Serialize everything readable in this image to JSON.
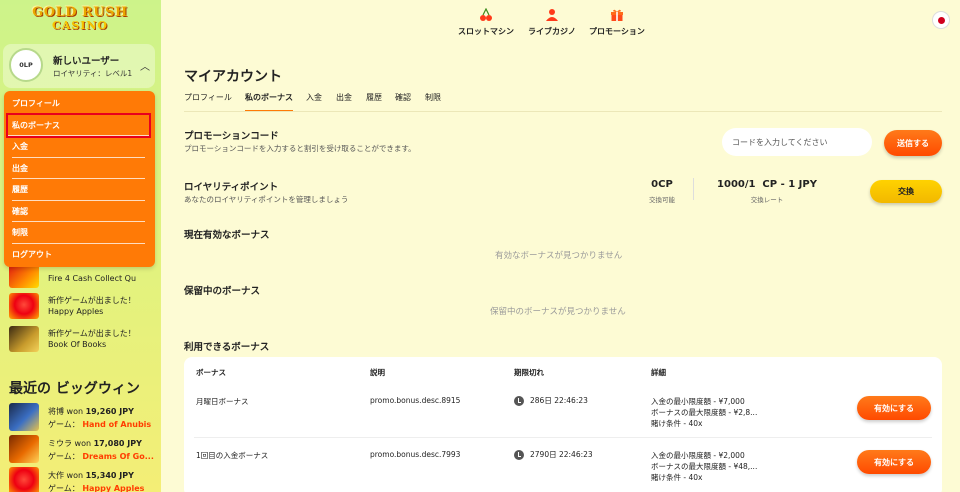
{
  "sidebar": {
    "logo": {
      "line1": "GOLD RUSH",
      "line2": "CASINO"
    },
    "user": {
      "points": "0LP",
      "name": "新しいユーザー",
      "level": "ロイヤリティ：レベル1"
    },
    "menu": [
      {
        "label": "プロフィール"
      },
      {
        "label": "私のボーナス"
      },
      {
        "label": "入金"
      },
      {
        "label": "出金"
      },
      {
        "label": "履歴"
      },
      {
        "label": "確認"
      },
      {
        "label": "制限"
      },
      {
        "label": "ログアウト"
      }
    ],
    "games": [
      {
        "line1": "Fire 4 Cash Collect Qu",
        "line2": ""
      },
      {
        "line1": "新作ゲームが出ました！",
        "line2": "Happy Apples"
      },
      {
        "line1": "新作ゲームが出ました！",
        "line2": "Book Of Books"
      }
    ],
    "bigwin_title": "最近の ビッグウィン",
    "wins": [
      {
        "player": "将博",
        "won_label": "won",
        "amount": "19,260 JPY",
        "game_label": "ゲーム：",
        "game": "Hand of Anubis"
      },
      {
        "player": "ミウラ",
        "won_label": "won",
        "amount": "17,080 JPY",
        "game_label": "ゲーム：",
        "game": "Dreams Of Go..."
      },
      {
        "player": "大作",
        "won_label": "won",
        "amount": "15,340 JPY",
        "game_label": "ゲーム：",
        "game": "Happy Apples"
      }
    ]
  },
  "topnav": {
    "slots": "スロットマシン",
    "live": "ライブカジノ",
    "promo": "プロモーション"
  },
  "main": {
    "title": "マイアカウント",
    "tabs": [
      "プロフィール",
      "私のボーナス",
      "入金",
      "出金",
      "履歴",
      "確認",
      "制限"
    ],
    "promo_code": {
      "title": "プロモーションコード",
      "subtitle": "プロモーションコードを入力すると割引を受け取ることができます。",
      "placeholder": "コードを入力してください",
      "submit": "送信する"
    },
    "loyalty": {
      "title": "ロイヤリティポイント",
      "subtitle": "あなたのロイヤリティポイントを管理しましょう",
      "cp_value": "0CP",
      "cp_label": "交換可能",
      "rate_value": "1000/1  CP - 1 JPY",
      "rate_label": "交換レート",
      "exchange": "交換"
    },
    "active_bonus": {
      "title": "現在有効なボーナス",
      "empty": "有効なボーナスが見つかりません"
    },
    "pending_bonus": {
      "title": "保留中のボーナス",
      "empty": "保留中のボーナスが見つかりません"
    },
    "available_bonus": {
      "title": "利用できるボーナス",
      "headers": {
        "bonus": "ボーナス",
        "desc": "説明",
        "expires": "期限切れ",
        "details": "詳細"
      },
      "rows": [
        {
          "name": "月曜日ボーナス",
          "desc": "promo.bonus.desc.8915",
          "expires": "286日 22:46:23",
          "details": [
            "入金の最小限度額 - ¥7,000",
            "ボーナスの最大限度額 - ¥2,8...",
            "賭け条件 - 40x"
          ],
          "action": "有効にする"
        },
        {
          "name": "1回目の入金ボーナス",
          "desc": "promo.bonus.desc.7993",
          "expires": "2790日 22:46:23",
          "details": [
            "入金の最小限度額 - ¥2,000",
            "ボーナスの最大限度額 - ¥48,...",
            "賭け条件 - 40x"
          ],
          "action": "有効にする"
        }
      ]
    }
  },
  "colors": {
    "accent": "#ff7a06",
    "button_orange": "#ff4a00",
    "button_yellow": "#ffd200",
    "page_bg": "#fdfbd4"
  }
}
